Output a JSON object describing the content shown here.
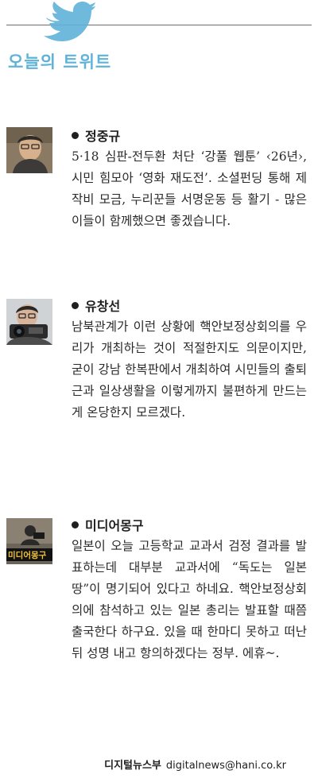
{
  "header": {
    "title": "오늘의 트위트",
    "icon": "twitter-bird-icon",
    "accent_color": "#5fb3d8"
  },
  "tweets": [
    {
      "author": "정중규",
      "avatar": "portrait-photo",
      "text": "5·18 심판-전두환 처단 ‘강풀 웹툰’ ‹26년›, 시민 힘모아 ‘영화 재도전’. 소셜펀딩 통해 제작비 모금, 누리꾼들 서명운동 등 활기 - 많은 이들이 함께했으면 좋겠습니다."
    },
    {
      "author": "유창선",
      "avatar": "portrait-with-camera-photo",
      "text": "남북관계가 이런 상황에 핵안보정상회의를 우리가 개최하는 것이 적절한지도 의문이지만, 굳이 강남 한복판에서 개최하여 시민들의 출퇴근과 일상생활을 이렇게까지 불편하게 만드는 게 온당한지 모르겠다."
    },
    {
      "author": "미디어몽구",
      "avatar": "media-mongu-logo",
      "avatar_text": "미디어몽구",
      "text": "일본이 오늘 고등학교 교과서 검정 결과를 발표하는데 대부분 교과서에 “독도는 일본 땅”이 명기되어 있다고 하네요. 핵안보정상회의에 참석하고 있는 일본 총리는 발표할 때쯤 출국한다 하구요. 있을 때 한마디 못하고 떠난 뒤 성명 내고 항의하겠다는 정부. 에휴~."
    }
  ],
  "footer": {
    "credit": "디지털뉴스부",
    "email": "digitalnews@hani.co.kr"
  }
}
